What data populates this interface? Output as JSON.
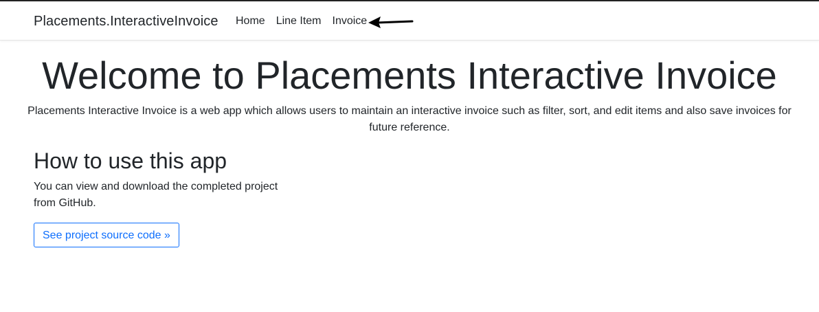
{
  "navbar": {
    "brand": "Placements.InteractiveInvoice",
    "links": [
      {
        "label": "Home"
      },
      {
        "label": "Line Item"
      },
      {
        "label": "Invoice"
      }
    ]
  },
  "hero": {
    "title": "Welcome to Placements Interactive Invoice",
    "description": "Placements Interactive Invoice is a web app which allows users to maintain an interactive invoice such as filter, sort, and edit items and also save invoices for future reference."
  },
  "section": {
    "heading": "How to use this app",
    "body": "You can view and download the completed project from GitHub.",
    "button_label": "See project source code »"
  },
  "icons": {
    "annotation_arrow": "arrow-left-icon"
  },
  "colors": {
    "link": "#0d6efd",
    "text": "#212529"
  }
}
